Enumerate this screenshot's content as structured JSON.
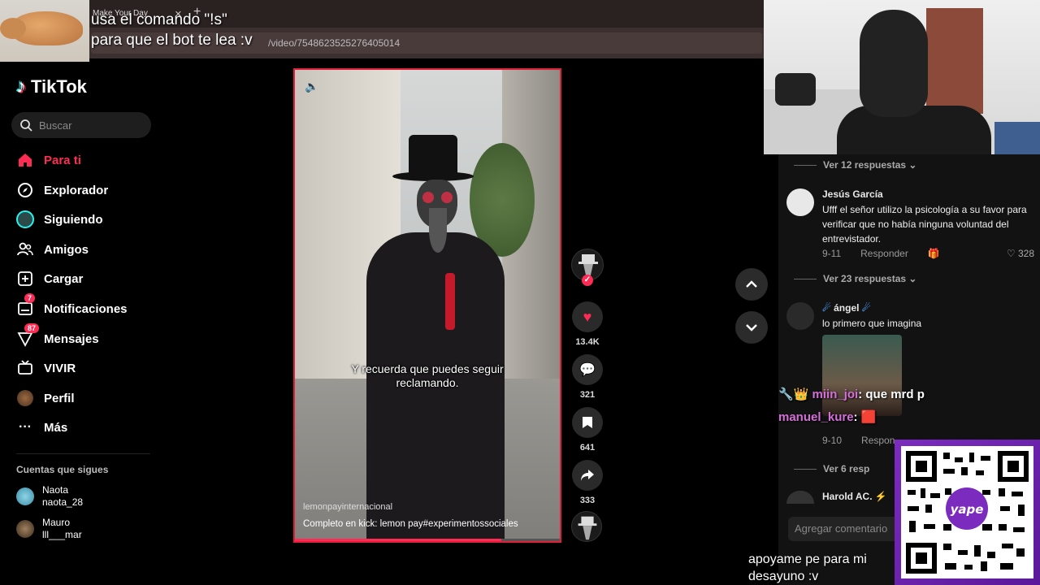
{
  "overlay": {
    "bot_line1": "usa el comando \"!s\"",
    "bot_line2": "para que el bot te lea :v",
    "donate_line1": "apoyame pe para mi",
    "donate_line2": "desayuno :v",
    "qr_label": "yape"
  },
  "browser": {
    "tab_title": "Make Your Day",
    "url": "/video/7548623525276405014"
  },
  "sidebar": {
    "logo": "TikTok",
    "search_placeholder": "Buscar",
    "items": [
      {
        "label": "Para ti",
        "icon": "home-icon",
        "active": true
      },
      {
        "label": "Explorador",
        "icon": "compass-icon"
      },
      {
        "label": "Siguiendo",
        "icon": "following-avatar-icon"
      },
      {
        "label": "Amigos",
        "icon": "friends-icon"
      },
      {
        "label": "Cargar",
        "icon": "upload-icon"
      },
      {
        "label": "Notificaciones",
        "icon": "inbox-icon",
        "badge": "7"
      },
      {
        "label": "Mensajes",
        "icon": "send-icon",
        "badge": "87"
      },
      {
        "label": "VIVIR",
        "icon": "live-tv-icon"
      },
      {
        "label": "Perfil",
        "icon": "profile-avatar-icon"
      },
      {
        "label": "Más",
        "icon": "more-dots-icon"
      }
    ],
    "following_header": "Cuentas que sigues",
    "following": [
      {
        "name": "Naota",
        "handle": "naota_28"
      },
      {
        "name": "Mauro",
        "handle": "lll___mar"
      }
    ]
  },
  "video": {
    "subtitle_line1": "Y recuerda que puedes seguir",
    "subtitle_line2": "reclamando.",
    "author": "lemonpayinternacional",
    "caption": "Completo en kick: lemon pay#experimentossociales",
    "progress_fraction": 0.78
  },
  "actions": {
    "likes": "13.4K",
    "comments": "321",
    "saves": "641",
    "shares": "333"
  },
  "comments": {
    "view_replies_1": "Ver 12 respuestas",
    "c1_user": "Jesús García",
    "c1_text": "Ufff el señor utilizo la psicología a su favor para verificar que no había ninguna voluntad del entrevistador.",
    "c1_date": "9-11",
    "reply_label": "Responder",
    "c1_likes": "328",
    "view_replies_2": "Ver 23 respuestas",
    "c2_user": "ángel",
    "c2_text": "lo primero que imagina",
    "c2_date": "9-10",
    "c2_reply": "Respon",
    "view_replies_3": "Ver 6 resp",
    "c3_user": "Harold AC.",
    "add_placeholder": "Agregar comentario"
  },
  "chat": [
    {
      "user": "miin_joi",
      "text": ": que mrd p"
    },
    {
      "user": "manuel_kure",
      "text": ":"
    }
  ],
  "colors": {
    "accent": "#fe2c55",
    "bg": "#000000",
    "video_border": "#e0203a",
    "chat_user": "#d46fd8"
  }
}
